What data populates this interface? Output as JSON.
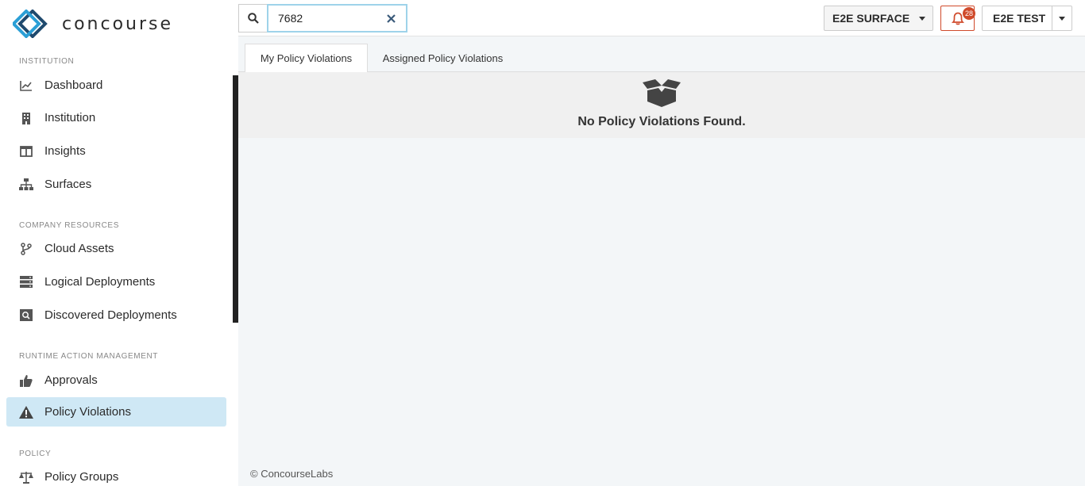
{
  "app": {
    "logo_text": "concourse"
  },
  "sidebar": {
    "sections": [
      {
        "title": "INSTITUTION"
      },
      {
        "title": "COMPANY RESOURCES"
      },
      {
        "title": "RUNTIME ACTION MANAGEMENT"
      },
      {
        "title": "POLICY"
      }
    ],
    "items": [
      {
        "label": "Dashboard",
        "icon": "chart-line-icon"
      },
      {
        "label": "Institution",
        "icon": "building-icon"
      },
      {
        "label": "Insights",
        "icon": "columns-icon"
      },
      {
        "label": "Surfaces",
        "icon": "sitemap-icon"
      },
      {
        "label": "Cloud Assets",
        "icon": "code-branch-icon"
      },
      {
        "label": "Logical Deployments",
        "icon": "server-icon"
      },
      {
        "label": "Discovered Deployments",
        "icon": "search-deployment-icon"
      },
      {
        "label": "Approvals",
        "icon": "thumbs-up-icon"
      },
      {
        "label": "Policy Violations",
        "icon": "warning-icon",
        "active": true
      },
      {
        "label": "Policy Groups",
        "icon": "balance-scale-icon"
      }
    ]
  },
  "topbar": {
    "search": {
      "value": "7682"
    },
    "surface_selector": "E2E SURFACE",
    "notifications_count": "28",
    "user_menu": "E2E TEST"
  },
  "main": {
    "tabs": [
      {
        "label": "My Policy Violations",
        "active": true
      },
      {
        "label": "Assigned Policy Violations",
        "active": false
      }
    ],
    "empty_message": "No Policy Violations Found.",
    "footer": "© ConcourseLabs"
  },
  "colors": {
    "accent": "#2b9fd6",
    "active_nav_bg": "#cfe8f5",
    "alert": "#d04a2b"
  }
}
